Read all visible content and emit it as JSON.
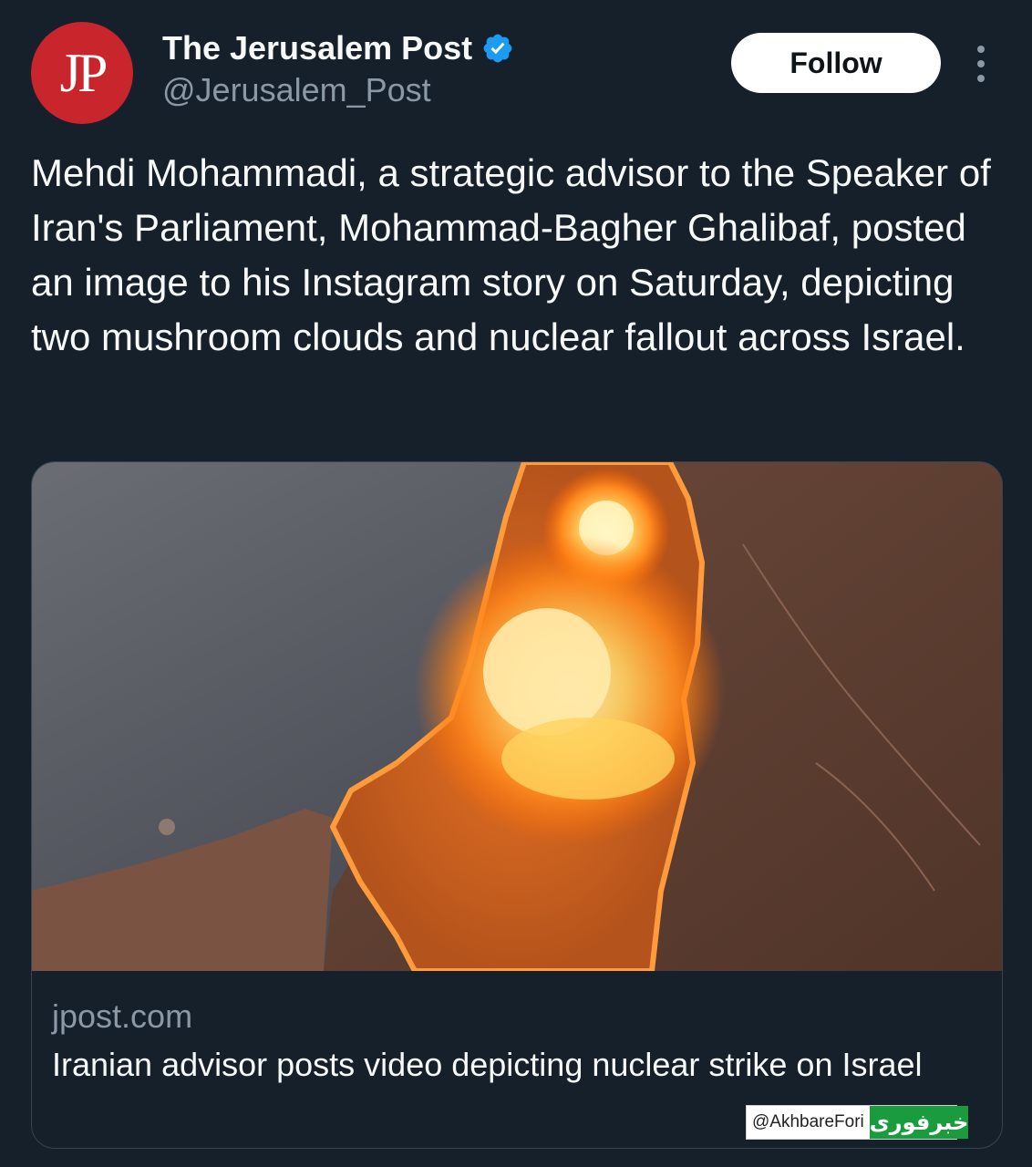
{
  "account": {
    "logo_text": "JP",
    "display_name": "The Jerusalem Post",
    "handle": "@Jerusalem_Post",
    "verified_icon": "verified-badge-icon",
    "avatar_color": "#c8252c",
    "verified_color": "#1d9bf0"
  },
  "actions": {
    "follow_label": "Follow",
    "more_icon": "more-vertical-icon"
  },
  "tweet": {
    "text": "Mehdi Mohammadi, a strategic advisor to the Speaker of Iran's Parliament, Mohammad-Bagher Ghalibaf, posted an image to his Instagram story on Saturday, depicting two mushroom clouds and nuclear fallout across Israel."
  },
  "link_card": {
    "domain": "jpost.com",
    "title": "Iranian advisor posts video depicting nuclear strike on Israel"
  },
  "watermark": {
    "handle": "@AkhbareFori",
    "logo_text": "خبرفوری",
    "logo_color": "#1a9c3e"
  },
  "colors": {
    "background": "#15202b",
    "text_primary": "#f7f9f9",
    "text_secondary": "#8b98a5",
    "border": "#38444d"
  }
}
